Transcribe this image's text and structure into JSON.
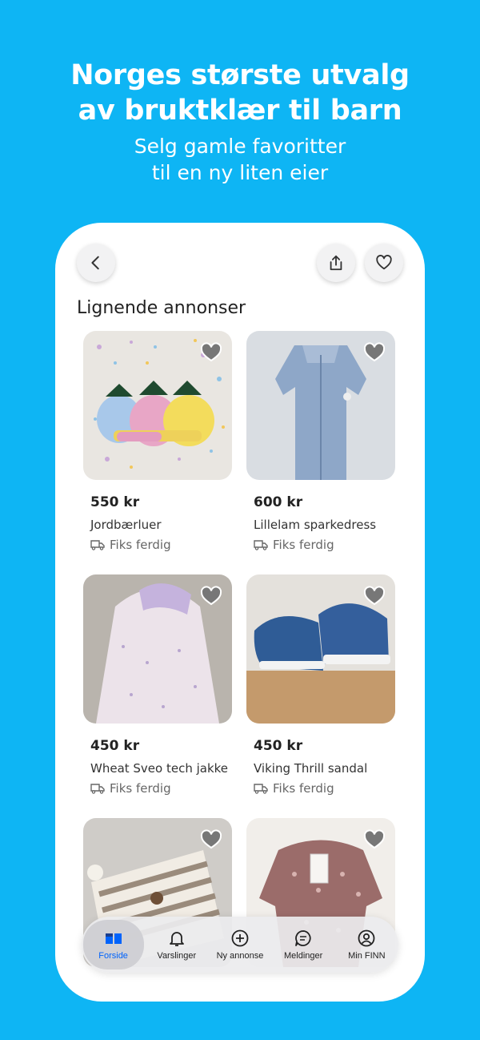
{
  "promo": {
    "headline_line1": "Norges største utvalg",
    "headline_line2": "av bruktklær til barn",
    "sub_line1": "Selg gamle favoritter",
    "sub_line2": "til en ny liten eier"
  },
  "section_title": "Lignende annonser",
  "listings": [
    {
      "price": "550 kr",
      "title": "Jordbærluer",
      "shipping": "Fiks ferdig"
    },
    {
      "price": "600 kr",
      "title": "Lillelam sparkedress",
      "shipping": "Fiks ferdig"
    },
    {
      "price": "450 kr",
      "title": "Wheat Sveo tech jakke",
      "shipping": "Fiks ferdig"
    },
    {
      "price": "450 kr",
      "title": "Viking Thrill sandal",
      "shipping": "Fiks ferdig"
    }
  ],
  "tabbar": {
    "home": "Forside",
    "notifications": "Varslinger",
    "new_ad": "Ny annonse",
    "messages": "Meldinger",
    "profile": "Min FINN"
  },
  "icons": [
    "back-icon",
    "share-icon",
    "heart-icon",
    "shipping-icon",
    "home-icon",
    "bell-icon",
    "plus-circle-icon",
    "chat-icon",
    "profile-icon"
  ],
  "colors": {
    "background": "#0EB5F4",
    "accent": "#0063FB"
  }
}
